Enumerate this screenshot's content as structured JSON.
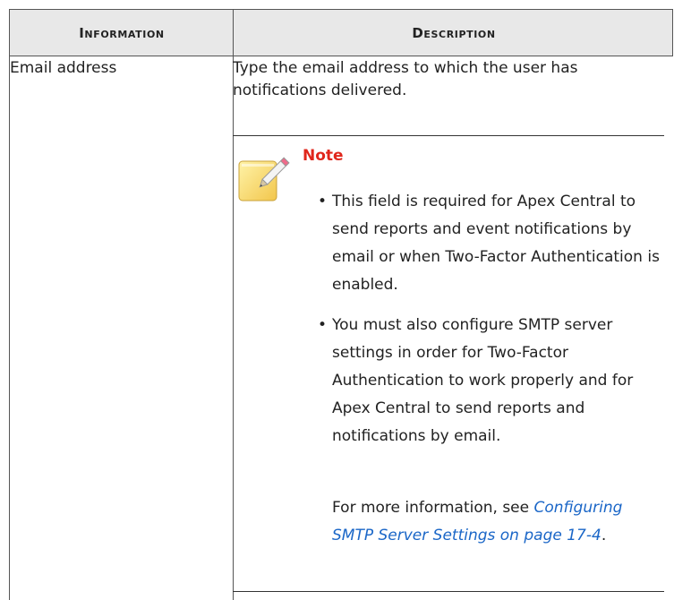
{
  "table": {
    "headers": {
      "information": "Information",
      "description": "Description"
    },
    "row": {
      "information": "Email address",
      "description": "Type the email address to which the user has notifications delivered."
    }
  },
  "note": {
    "icon": "note-pencil-icon",
    "label": "Note",
    "bullets": [
      "This field is required for Apex Central to send reports and event notifications by email or when Two-Factor Authentication is enabled.",
      "You must also configure SMTP server settings in order for Two-Factor Authentication to work properly and for Apex Central to send reports and notifications by email."
    ],
    "more_info_prefix": "For more information, see ",
    "link_text": "Configuring SMTP Server Settings on page 17-4",
    "more_info_suffix": "."
  },
  "colors": {
    "header_bg": "#e8e8e8",
    "note_label": "#e0261b",
    "link": "#1a66c7",
    "border": "#555555"
  }
}
